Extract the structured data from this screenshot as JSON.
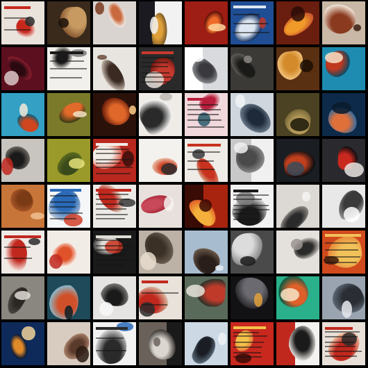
{
  "grid": {
    "columns": 8,
    "rows": 8
  },
  "tiles": [
    {
      "bg": "#e9e3dc",
      "a": "#c8281c",
      "b": "#2c2c2c",
      "c": "#f2efe9",
      "kind": "doc"
    },
    {
      "bg": "#3a2a1c",
      "a": "#c79a61",
      "b": "#1b120a",
      "c": "#8b5a33",
      "kind": "blob"
    },
    {
      "bg": "#d9d4cf",
      "a": "#c96a3e",
      "b": "#7a3a1f",
      "c": "#f1ece6",
      "kind": "blob"
    },
    {
      "bg": "#1a1a20",
      "a": "#e0a13a",
      "b": "#f2f2f2",
      "c": "#7a5a2a",
      "kind": "split"
    },
    {
      "bg": "#9e1d14",
      "a": "#ef6b2a",
      "b": "#ffd59a",
      "c": "#5a0d08",
      "kind": "blob"
    },
    {
      "bg": "#1f4e94",
      "a": "#dde6f2",
      "b": "#c0392b",
      "c": "#0d2b5c",
      "kind": "doc"
    },
    {
      "bg": "#6a1e0f",
      "a": "#f09a2a",
      "b": "#2a0c06",
      "c": "#c8532a",
      "kind": "blob"
    },
    {
      "bg": "#c9b8a5",
      "a": "#8a3a1f",
      "b": "#3a1d10",
      "c": "#f0e4d6",
      "kind": "blob"
    },
    {
      "bg": "#5c0f1e",
      "a": "#2a0a10",
      "b": "#d8c8c8",
      "c": "#8a1d2e",
      "kind": "blob"
    },
    {
      "bg": "#f2f0ec",
      "a": "#1a1a1a",
      "b": "#7a7a7a",
      "c": "#e0ddd8",
      "kind": "doc"
    },
    {
      "bg": "#e8e4df",
      "a": "#3a2a22",
      "b": "#6a4a3a",
      "c": "#bfb2a6",
      "kind": "blob"
    },
    {
      "bg": "#2a2a2a",
      "a": "#c63a2e",
      "b": "#e6e0d8",
      "c": "#7a1a12",
      "kind": "doc"
    },
    {
      "bg": "#d8dadd",
      "a": "#3a3a3e",
      "b": "#ffffff",
      "c": "#8a8c90",
      "kind": "split"
    },
    {
      "bg": "#3b3a36",
      "a": "#1a1a18",
      "b": "#8a8580",
      "c": "#5c5a55",
      "kind": "blob"
    },
    {
      "bg": "#5a3012",
      "a": "#d38a2a",
      "b": "#1c0e04",
      "c": "#f2c27a",
      "kind": "blob"
    },
    {
      "bg": "#1e8cb0",
      "a": "#c0381e",
      "b": "#f6e2c8",
      "c": "#0d4a66",
      "kind": "blob"
    },
    {
      "bg": "#33a0c4",
      "a": "#d0461e",
      "b": "#f2e8d8",
      "c": "#0f5f7a",
      "kind": "blob"
    },
    {
      "bg": "#7a7a2a",
      "a": "#e06a2a",
      "b": "#f3e2c4",
      "c": "#3a3a14",
      "kind": "blob"
    },
    {
      "bg": "#2a120a",
      "a": "#e0672a",
      "b": "#ffd08a",
      "c": "#6a1e0a",
      "kind": "blob"
    },
    {
      "bg": "#efece8",
      "a": "#2a2a2a",
      "b": "#bdb8b2",
      "c": "#f7f6f4",
      "kind": "blob"
    },
    {
      "bg": "#f0d8dc",
      "a": "#b81e3a",
      "b": "#2a5a6a",
      "c": "#f7eef0",
      "kind": "doc"
    },
    {
      "bg": "#cfd6de",
      "a": "#1e2a3a",
      "b": "#f2f4f6",
      "c": "#6a7a8a",
      "kind": "blob"
    },
    {
      "bg": "#4a4222",
      "a": "#b59a5a",
      "b": "#1a1608",
      "c": "#7a6a3a",
      "kind": "blob"
    },
    {
      "bg": "#0d2a4a",
      "a": "#e0703a",
      "b": "#0a1a2a",
      "c": "#3a6a9a",
      "kind": "blob"
    },
    {
      "bg": "#c8c4bf",
      "a": "#1a1a1a",
      "b": "#c0281e",
      "c": "#6a6660",
      "kind": "blob"
    },
    {
      "bg": "#9a9a2a",
      "a": "#3a4a1a",
      "b": "#e6e27a",
      "c": "#5a6a1e",
      "kind": "blob"
    },
    {
      "bg": "#b8281e",
      "a": "#f2ece6",
      "b": "#3a0e0a",
      "c": "#e06a5a",
      "kind": "doc"
    },
    {
      "bg": "#f4f2ee",
      "a": "#d0452a",
      "b": "#2a2a2a",
      "c": "#e8c0a8",
      "kind": "blob"
    },
    {
      "bg": "#efebe6",
      "a": "#c8321e",
      "b": "#3a3a3a",
      "c": "#d8a890",
      "kind": "doc"
    },
    {
      "bg": "#c8c8c8",
      "a": "#4a4a4a",
      "b": "#f0f0f0",
      "c": "#8a8a8a",
      "kind": "split"
    },
    {
      "bg": "#1a1e22",
      "a": "#c0401e",
      "b": "#3a4a5a",
      "c": "#0a0c10",
      "kind": "blob"
    },
    {
      "bg": "#2a2a2e",
      "a": "#c8281e",
      "b": "#e8e4e0",
      "c": "#0c0c10",
      "kind": "blob"
    },
    {
      "bg": "#c8753a",
      "a": "#7a3a14",
      "b": "#f0c090",
      "c": "#a55426",
      "kind": "blob"
    },
    {
      "bg": "#f4f6f8",
      "a": "#2a6ab8",
      "b": "#d0402a",
      "c": "#b8c8d8",
      "kind": "doc"
    },
    {
      "bg": "#eceae6",
      "a": "#c0281e",
      "b": "#3a3a3a",
      "c": "#e0d6c8",
      "kind": "doc"
    },
    {
      "bg": "#e8e0dc",
      "a": "#c84a5a",
      "b": "#f6f2f0",
      "c": "#a8283a",
      "kind": "blob"
    },
    {
      "bg": "#a8240e",
      "a": "#f4b03a",
      "b": "#3a0a04",
      "c": "#e0602a",
      "kind": "split"
    },
    {
      "bg": "#f2f2f2",
      "a": "#1a1a1a",
      "b": "#7a7a7a",
      "c": "#d8d8d8",
      "kind": "doc"
    },
    {
      "bg": "#dcd8d4",
      "a": "#2a2a2a",
      "b": "#f6f4f2",
      "c": "#8a8682",
      "kind": "blob"
    },
    {
      "bg": "#e8e8e8",
      "a": "#3a3a3a",
      "b": "#ffffff",
      "c": "#9a9a9a",
      "kind": "blob"
    },
    {
      "bg": "#efeae6",
      "a": "#c0281e",
      "b": "#2a2a2a",
      "c": "#f6e2dc",
      "kind": "doc"
    },
    {
      "bg": "#f2ece6",
      "a": "#e0532a",
      "b": "#c0281e",
      "c": "#faf6f2",
      "kind": "blob"
    },
    {
      "bg": "#1a1a1a",
      "a": "#e0dcd6",
      "b": "#c8321e",
      "c": "#3a3a3a",
      "kind": "doc"
    },
    {
      "bg": "#bcb2a6",
      "a": "#3a3026",
      "b": "#e8dccc",
      "c": "#6a5e50",
      "kind": "blob"
    },
    {
      "bg": "#a8bcd0",
      "a": "#2a1e1a",
      "b": "#e6eef4",
      "c": "#6a5a4a",
      "kind": "blob"
    },
    {
      "bg": "#4a4a4a",
      "a": "#dcdcdc",
      "b": "#1a1a1a",
      "c": "#8a8a8a",
      "kind": "blob"
    },
    {
      "bg": "#e4e0dc",
      "a": "#2a2a2a",
      "b": "#9a9490",
      "c": "#c8c2bc",
      "kind": "blob"
    },
    {
      "bg": "#d04a1e",
      "a": "#f2c25a",
      "b": "#3a1a0a",
      "c": "#e88a3a",
      "kind": "doc"
    },
    {
      "bg": "#8a8680",
      "a": "#2a2622",
      "b": "#e0dcd6",
      "c": "#4a4640",
      "kind": "blob"
    },
    {
      "bg": "#1e4a5a",
      "a": "#d0502a",
      "b": "#0a1e26",
      "c": "#8ab8c8",
      "kind": "blob"
    },
    {
      "bg": "#e6e4e2",
      "a": "#1a1a1a",
      "b": "#f8f8f8",
      "c": "#7a7876",
      "kind": "blob"
    },
    {
      "bg": "#e8e2da",
      "a": "#c0281e",
      "b": "#2a2a2a",
      "c": "#d8b8a0",
      "kind": "doc"
    },
    {
      "bg": "#5a6a5a",
      "a": "#c03a2a",
      "b": "#e8e4dc",
      "c": "#2a322a",
      "kind": "blob"
    },
    {
      "bg": "#121214",
      "a": "#6a6a70",
      "b": "#e0a03a",
      "c": "#2a2a2e",
      "kind": "blob"
    },
    {
      "bg": "#2ab08a",
      "a": "#e0602a",
      "b": "#f4e4c8",
      "c": "#0a5a44",
      "kind": "blob"
    },
    {
      "bg": "#9aa4b0",
      "a": "#2a2e34",
      "b": "#e6eaee",
      "c": "#5a6470",
      "kind": "blob"
    },
    {
      "bg": "#0d2a5a",
      "a": "#e08a2a",
      "b": "#f2d29a",
      "c": "#061534",
      "kind": "blob"
    },
    {
      "bg": "#d8ccc0",
      "a": "#5a3a2a",
      "b": "#2a1a12",
      "c": "#a8806a",
      "kind": "blob"
    },
    {
      "bg": "#f2f2f2",
      "a": "#2a2a2a",
      "b": "#2a6ab8",
      "c": "#d8d8d8",
      "kind": "doc"
    },
    {
      "bg": "#1a1a1a",
      "a": "#dcd6d0",
      "b": "#6a625a",
      "c": "#3a3632",
      "kind": "split"
    },
    {
      "bg": "#ccd8e4",
      "a": "#1a1e24",
      "b": "#eef2f6",
      "c": "#5a6a7a",
      "kind": "blob"
    },
    {
      "bg": "#c8281e",
      "a": "#f2c24a",
      "b": "#3a0a06",
      "c": "#e87a3a",
      "kind": "doc"
    },
    {
      "bg": "#f4f2f0",
      "a": "#1a1a1a",
      "b": "#c0281e",
      "c": "#e0dcd8",
      "kind": "split"
    },
    {
      "bg": "#e8e0d8",
      "a": "#c0281e",
      "b": "#2a2a2a",
      "c": "#f0c8a8",
      "kind": "doc"
    }
  ]
}
